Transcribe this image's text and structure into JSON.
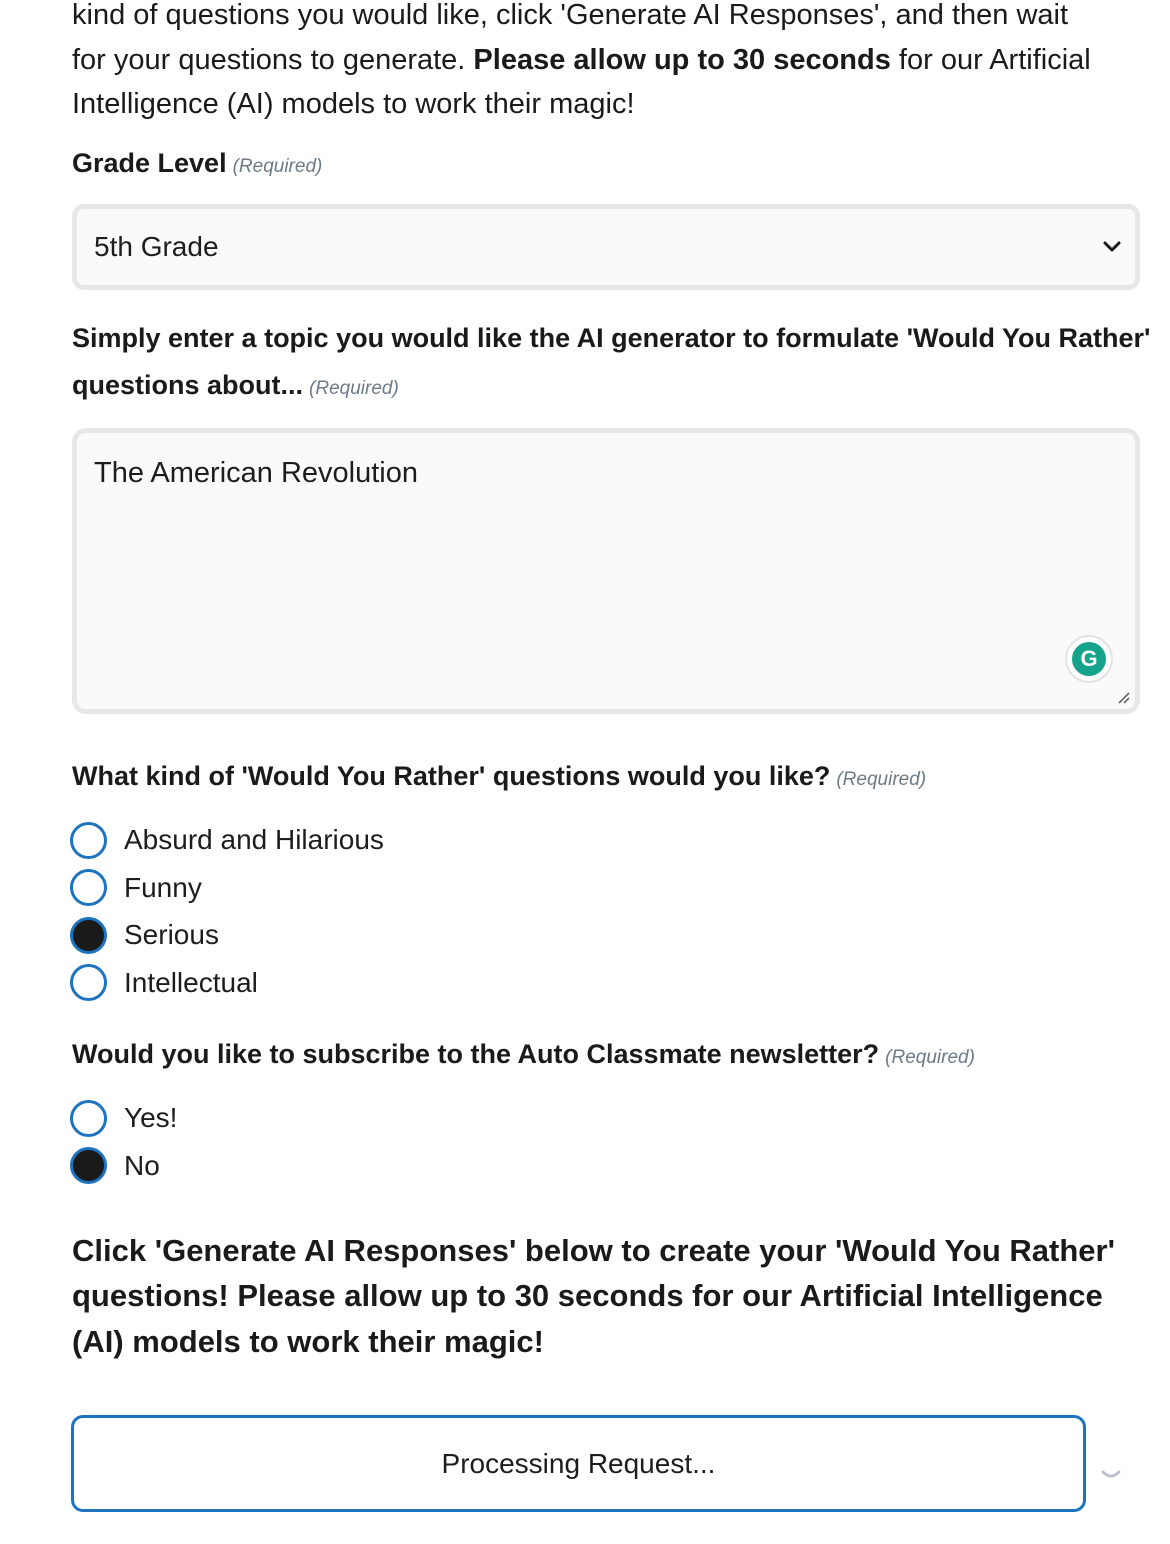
{
  "intro": {
    "line1": "kind of questions you would like, click 'Generate AI Responses', and then wait",
    "line2_pre": "for your questions to generate. ",
    "line2_bold": "Please allow up to 30 seconds",
    "line2_post": " for our Artificial",
    "line3": "Intelligence (AI) models to work their magic!"
  },
  "grade_level": {
    "label": "Grade Level",
    "required": "(Required)",
    "selected": "5th Grade"
  },
  "topic": {
    "label": "Simply enter a topic you would like the AI generator to formulate 'Would You Rather' questions about...",
    "required": "(Required)",
    "value": "The American Revolution"
  },
  "question_kind": {
    "label": "What kind of 'Would You Rather' questions would you like?",
    "required": "(Required)",
    "options": [
      {
        "label": "Absurd and Hilarious",
        "checked": false
      },
      {
        "label": "Funny",
        "checked": false
      },
      {
        "label": "Serious",
        "checked": true
      },
      {
        "label": "Intellectual",
        "checked": false
      }
    ]
  },
  "newsletter": {
    "label": "Would you like to subscribe to the Auto Classmate newsletter?",
    "required": "(Required)",
    "options": [
      {
        "label": "Yes!",
        "checked": false
      },
      {
        "label": "No",
        "checked": true
      }
    ]
  },
  "cta": {
    "text": "Click 'Generate AI Responses' below to create your 'Would You Rather' questions! Please allow up to 30 seconds for our Artificial Intelligence (AI) models to work their magic!"
  },
  "submit": {
    "label": "Processing Request..."
  },
  "icons": {
    "grammarly": "G"
  },
  "colors": {
    "accent": "#1e73be",
    "grammarly": "#15a38b"
  }
}
